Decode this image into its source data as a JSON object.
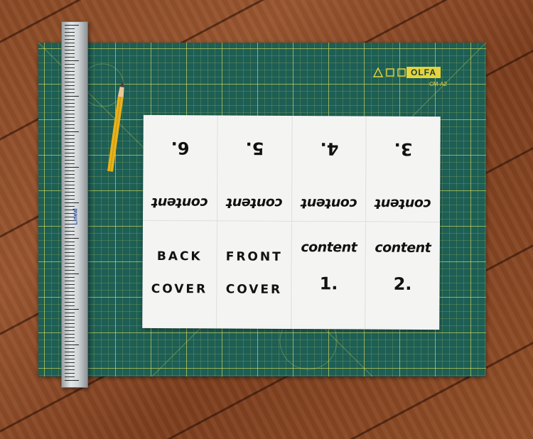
{
  "mat": {
    "brand": "OLFA",
    "model": "CM-A2",
    "colors": {
      "mat": "#1d5e55",
      "grid": "#dce25a",
      "floor": "#8b4a26"
    }
  },
  "ruler": {
    "brand": "Lineal"
  },
  "leaflet": {
    "top_row_upside_down": [
      {
        "number": "6.",
        "word": "content"
      },
      {
        "number": "5.",
        "word": "content"
      },
      {
        "number": "4.",
        "word": "content"
      },
      {
        "number": "3.",
        "word": "content"
      }
    ],
    "bottom_row": [
      {
        "line1": "BACK",
        "line2": "COVER"
      },
      {
        "line1": "FRONT",
        "line2": "COVER"
      },
      {
        "line1": "content",
        "line2": "1."
      },
      {
        "line1": "content",
        "line2": "2."
      }
    ]
  }
}
